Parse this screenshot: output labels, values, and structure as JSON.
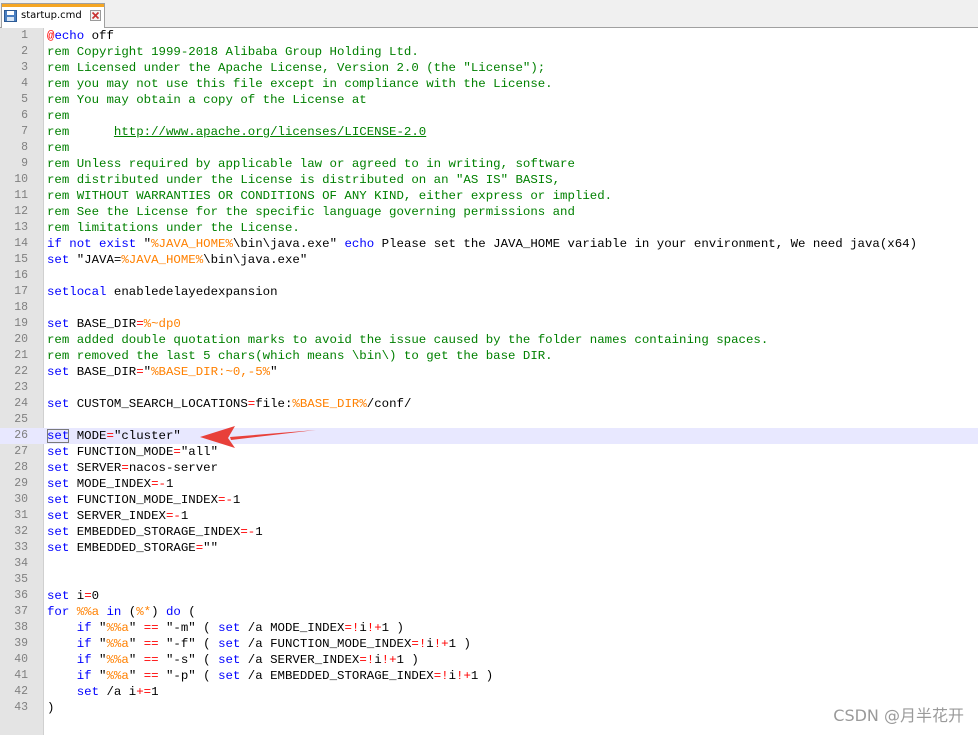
{
  "tab": {
    "title": "startup.cmd",
    "icon": "save-file-icon",
    "close_icon": "close-icon"
  },
  "accent_colors": {
    "keyword": "#0000ff",
    "comment": "#008000",
    "variable": "#ff8000",
    "operator": "#ff0000",
    "current_line": "#e8e8ff",
    "annotation_arrow": "#e8403a"
  },
  "current_line": 26,
  "lines": [
    {
      "n": "1",
      "tokens": [
        [
          "op",
          "@"
        ],
        [
          "kw",
          "echo"
        ],
        [
          "tx",
          " off"
        ]
      ]
    },
    {
      "n": "2",
      "tokens": [
        [
          "cm",
          "rem Copyright 1999-2018 Alibaba Group Holding Ltd."
        ]
      ]
    },
    {
      "n": "3",
      "tokens": [
        [
          "cm",
          "rem Licensed under the Apache License, Version 2.0 (the \"License\");"
        ]
      ]
    },
    {
      "n": "4",
      "tokens": [
        [
          "cm",
          "rem you may not use this file except in compliance with the License."
        ]
      ]
    },
    {
      "n": "5",
      "tokens": [
        [
          "cm",
          "rem You may obtain a copy of the License at"
        ]
      ]
    },
    {
      "n": "6",
      "tokens": [
        [
          "cm",
          "rem"
        ]
      ]
    },
    {
      "n": "7",
      "tokens": [
        [
          "cm",
          "rem      "
        ],
        [
          "url",
          "http://www.apache.org/licenses/LICENSE-2.0"
        ]
      ]
    },
    {
      "n": "8",
      "tokens": [
        [
          "cm",
          "rem"
        ]
      ]
    },
    {
      "n": "9",
      "tokens": [
        [
          "cm",
          "rem Unless required by applicable law or agreed to in writing, software"
        ]
      ]
    },
    {
      "n": "10",
      "tokens": [
        [
          "cm",
          "rem distributed under the License is distributed on an \"AS IS\" BASIS,"
        ]
      ]
    },
    {
      "n": "11",
      "tokens": [
        [
          "cm",
          "rem WITHOUT WARRANTIES OR CONDITIONS OF ANY KIND, either express or implied."
        ]
      ]
    },
    {
      "n": "12",
      "tokens": [
        [
          "cm",
          "rem See the License for the specific language governing permissions and"
        ]
      ]
    },
    {
      "n": "13",
      "tokens": [
        [
          "cm",
          "rem limitations under the License."
        ]
      ]
    },
    {
      "n": "14",
      "tokens": [
        [
          "kw",
          "if not exist"
        ],
        [
          "tx",
          " \""
        ],
        [
          "vr",
          "%JAVA_HOME%"
        ],
        [
          "tx",
          "\\bin\\java.exe\" "
        ],
        [
          "kw",
          "echo"
        ],
        [
          "tx",
          " Please set the JAVA_HOME variable in your environment, We need java(x64)"
        ]
      ]
    },
    {
      "n": "15",
      "tokens": [
        [
          "kw",
          "set"
        ],
        [
          "tx",
          " \"JAVA="
        ],
        [
          "vr",
          "%JAVA_HOME%"
        ],
        [
          "tx",
          "\\bin\\java.exe\""
        ]
      ]
    },
    {
      "n": "16",
      "tokens": []
    },
    {
      "n": "17",
      "tokens": [
        [
          "kw",
          "setlocal"
        ],
        [
          "tx",
          " enabledelayedexpansion"
        ]
      ]
    },
    {
      "n": "18",
      "tokens": []
    },
    {
      "n": "19",
      "tokens": [
        [
          "kw",
          "set"
        ],
        [
          "tx",
          " BASE_DIR"
        ],
        [
          "op",
          "="
        ],
        [
          "vr",
          "%~dp0"
        ]
      ]
    },
    {
      "n": "20",
      "tokens": [
        [
          "cm",
          "rem added double quotation marks to avoid the issue caused by the folder names containing spaces."
        ]
      ]
    },
    {
      "n": "21",
      "tokens": [
        [
          "cm",
          "rem removed the last 5 chars(which means \\bin\\) to get the base DIR."
        ]
      ]
    },
    {
      "n": "22",
      "tokens": [
        [
          "kw",
          "set"
        ],
        [
          "tx",
          " BASE_DIR"
        ],
        [
          "op",
          "="
        ],
        [
          "tx",
          "\""
        ],
        [
          "vr",
          "%BASE_DIR:~0,-5%"
        ],
        [
          "tx",
          "\""
        ]
      ]
    },
    {
      "n": "23",
      "tokens": []
    },
    {
      "n": "24",
      "tokens": [
        [
          "kw",
          "set"
        ],
        [
          "tx",
          " CUSTOM_SEARCH_LOCATIONS"
        ],
        [
          "op",
          "="
        ],
        [
          "tx",
          "file:"
        ],
        [
          "vr",
          "%BASE_DIR%"
        ],
        [
          "tx",
          "/conf/"
        ]
      ]
    },
    {
      "n": "25",
      "tokens": []
    },
    {
      "n": "26",
      "tokens": [
        [
          "kwsel",
          "set"
        ],
        [
          "tx",
          " MODE"
        ],
        [
          "op",
          "="
        ],
        [
          "tx",
          "\"cluster\""
        ]
      ]
    },
    {
      "n": "27",
      "tokens": [
        [
          "kw",
          "set"
        ],
        [
          "tx",
          " FUNCTION_MODE"
        ],
        [
          "op",
          "="
        ],
        [
          "tx",
          "\"all\""
        ]
      ]
    },
    {
      "n": "28",
      "tokens": [
        [
          "kw",
          "set"
        ],
        [
          "tx",
          " SERVER"
        ],
        [
          "op",
          "="
        ],
        [
          "tx",
          "nacos-server"
        ]
      ]
    },
    {
      "n": "29",
      "tokens": [
        [
          "kw",
          "set"
        ],
        [
          "tx",
          " MODE_INDEX"
        ],
        [
          "op",
          "=-"
        ],
        [
          "tx",
          "1"
        ]
      ]
    },
    {
      "n": "30",
      "tokens": [
        [
          "kw",
          "set"
        ],
        [
          "tx",
          " FUNCTION_MODE_INDEX"
        ],
        [
          "op",
          "=-"
        ],
        [
          "tx",
          "1"
        ]
      ]
    },
    {
      "n": "31",
      "tokens": [
        [
          "kw",
          "set"
        ],
        [
          "tx",
          " SERVER_INDEX"
        ],
        [
          "op",
          "=-"
        ],
        [
          "tx",
          "1"
        ]
      ]
    },
    {
      "n": "32",
      "tokens": [
        [
          "kw",
          "set"
        ],
        [
          "tx",
          " EMBEDDED_STORAGE_INDEX"
        ],
        [
          "op",
          "=-"
        ],
        [
          "tx",
          "1"
        ]
      ]
    },
    {
      "n": "33",
      "tokens": [
        [
          "kw",
          "set"
        ],
        [
          "tx",
          " EMBEDDED_STORAGE"
        ],
        [
          "op",
          "="
        ],
        [
          "tx",
          "\"\""
        ]
      ]
    },
    {
      "n": "34",
      "tokens": []
    },
    {
      "n": "35",
      "tokens": []
    },
    {
      "n": "36",
      "tokens": [
        [
          "kw",
          "set"
        ],
        [
          "tx",
          " i"
        ],
        [
          "op",
          "="
        ],
        [
          "tx",
          "0"
        ]
      ]
    },
    {
      "n": "37",
      "tokens": [
        [
          "kw",
          "for"
        ],
        [
          "tx",
          " "
        ],
        [
          "vr",
          "%%a"
        ],
        [
          "tx",
          " "
        ],
        [
          "kw",
          "in"
        ],
        [
          "tx",
          " ("
        ],
        [
          "vr",
          "%*"
        ],
        [
          "tx",
          ") "
        ],
        [
          "kw",
          "do"
        ],
        [
          "tx",
          " ("
        ]
      ]
    },
    {
      "n": "38",
      "tokens": [
        [
          "tx",
          "    "
        ],
        [
          "kw",
          "if"
        ],
        [
          "tx",
          " \""
        ],
        [
          "vr",
          "%%a"
        ],
        [
          "tx",
          "\" "
        ],
        [
          "op",
          "=="
        ],
        [
          "tx",
          " \"-m\" ( "
        ],
        [
          "kw",
          "set"
        ],
        [
          "tx",
          " /a MODE_INDEX"
        ],
        [
          "op",
          "=!"
        ],
        [
          "tx",
          "i"
        ],
        [
          "op",
          "!+"
        ],
        [
          "tx",
          "1 )"
        ]
      ]
    },
    {
      "n": "39",
      "tokens": [
        [
          "tx",
          "    "
        ],
        [
          "kw",
          "if"
        ],
        [
          "tx",
          " \""
        ],
        [
          "vr",
          "%%a"
        ],
        [
          "tx",
          "\" "
        ],
        [
          "op",
          "=="
        ],
        [
          "tx",
          " \"-f\" ( "
        ],
        [
          "kw",
          "set"
        ],
        [
          "tx",
          " /a FUNCTION_MODE_INDEX"
        ],
        [
          "op",
          "=!"
        ],
        [
          "tx",
          "i"
        ],
        [
          "op",
          "!+"
        ],
        [
          "tx",
          "1 )"
        ]
      ]
    },
    {
      "n": "40",
      "tokens": [
        [
          "tx",
          "    "
        ],
        [
          "kw",
          "if"
        ],
        [
          "tx",
          " \""
        ],
        [
          "vr",
          "%%a"
        ],
        [
          "tx",
          "\" "
        ],
        [
          "op",
          "=="
        ],
        [
          "tx",
          " \"-s\" ( "
        ],
        [
          "kw",
          "set"
        ],
        [
          "tx",
          " /a SERVER_INDEX"
        ],
        [
          "op",
          "=!"
        ],
        [
          "tx",
          "i"
        ],
        [
          "op",
          "!+"
        ],
        [
          "tx",
          "1 )"
        ]
      ]
    },
    {
      "n": "41",
      "tokens": [
        [
          "tx",
          "    "
        ],
        [
          "kw",
          "if"
        ],
        [
          "tx",
          " \""
        ],
        [
          "vr",
          "%%a"
        ],
        [
          "tx",
          "\" "
        ],
        [
          "op",
          "=="
        ],
        [
          "tx",
          " \"-p\" ( "
        ],
        [
          "kw",
          "set"
        ],
        [
          "tx",
          " /a EMBEDDED_STORAGE_INDEX"
        ],
        [
          "op",
          "=!"
        ],
        [
          "tx",
          "i"
        ],
        [
          "op",
          "!+"
        ],
        [
          "tx",
          "1 )"
        ]
      ]
    },
    {
      "n": "42",
      "tokens": [
        [
          "tx",
          "    "
        ],
        [
          "kw",
          "set"
        ],
        [
          "tx",
          " /a i"
        ],
        [
          "op",
          "+="
        ],
        [
          "tx",
          "1"
        ]
      ]
    },
    {
      "n": "43",
      "tokens": [
        [
          "tx",
          ")"
        ]
      ]
    }
  ],
  "watermark": "CSDN @月半花开"
}
